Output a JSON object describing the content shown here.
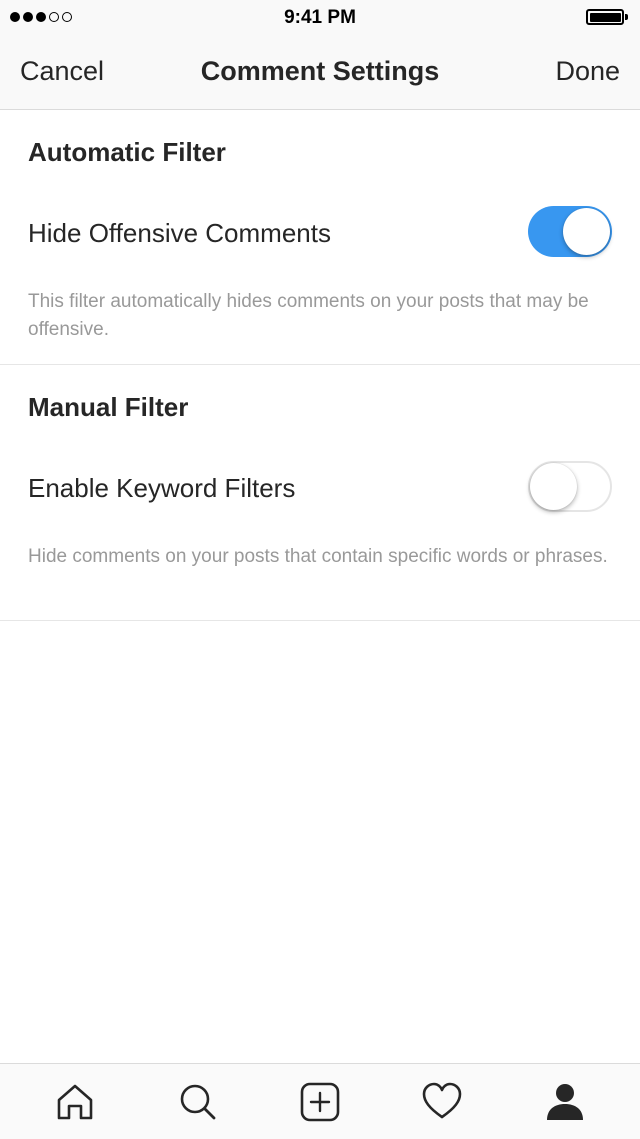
{
  "status_bar": {
    "time": "9:41 PM",
    "signal_filled": 3,
    "signal_total": 5
  },
  "nav": {
    "cancel_label": "Cancel",
    "title": "Comment Settings",
    "done_label": "Done"
  },
  "sections": {
    "automatic": {
      "title": "Automatic Filter",
      "row_label": "Hide Offensive Comments",
      "toggle_on": true,
      "description": "This filter automatically hides comments on your posts that may be offensive."
    },
    "manual": {
      "title": "Manual Filter",
      "row_label": "Enable Keyword Filters",
      "toggle_on": false,
      "description": "Hide comments on your posts that contain specific words or phrases."
    }
  },
  "tab_bar": {
    "items": [
      "home-icon",
      "search-icon",
      "add-post-icon",
      "heart-icon",
      "profile-icon"
    ],
    "active": "profile-icon"
  },
  "colors": {
    "toggle_on": "#3897f0",
    "text_primary": "#262626",
    "text_secondary": "#999999",
    "bar_background": "#f9f9f9"
  }
}
